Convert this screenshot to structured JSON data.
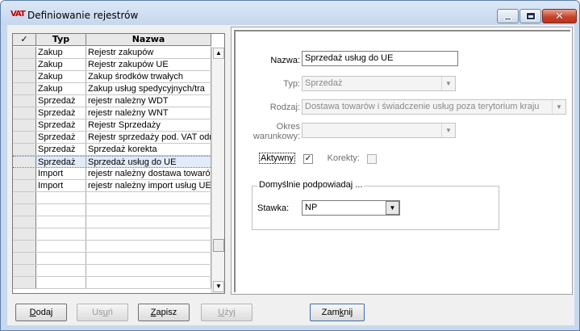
{
  "window": {
    "title": "Definiowanie rejestrów",
    "icon_text": "VAT"
  },
  "grid": {
    "columns": [
      "✓",
      "Typ",
      "Nazwa"
    ],
    "rows": [
      {
        "typ": "Zakup",
        "nazwa": "Rejestr zakupów"
      },
      {
        "typ": "Zakup",
        "nazwa": "Rejestr zakupów UE"
      },
      {
        "typ": "Zakup",
        "nazwa": "Zakup środków trwałych"
      },
      {
        "typ": "Zakup",
        "nazwa": "Zakup usług spedycyjnych/tra"
      },
      {
        "typ": "Sprzedaż",
        "nazwa": "rejestr należny WDT"
      },
      {
        "typ": "Sprzedaż",
        "nazwa": "rejestr należny WNT"
      },
      {
        "typ": "Sprzedaż",
        "nazwa": "Rejestr Sprzedaży"
      },
      {
        "typ": "Sprzedaż",
        "nazwa": "Rejestr sprzedaży pod. VAT odr"
      },
      {
        "typ": "Sprzedaż",
        "nazwa": "Sprzedaż korekta"
      },
      {
        "typ": "Sprzedaż",
        "nazwa": "Sprzedaż usług do UE"
      },
      {
        "typ": "Import",
        "nazwa": "rejestr należny dostawa towaró"
      },
      {
        "typ": "Import",
        "nazwa": "rejestr należny import usług UE"
      }
    ],
    "selected_index": 9,
    "empty_rows": 8
  },
  "form": {
    "nazwa_label": "Nazwa:",
    "nazwa_value": "Sprzedaż usług do UE",
    "typ_label": "Typ:",
    "typ_value": "Sprzedaż",
    "rodzaj_label": "Rodzaj:",
    "rodzaj_value": "Dostawa towarów i świadczenie usług poza terytorium kraju",
    "okres_label_1": "Okres",
    "okres_label_2": "warunkowy:",
    "okres_value": "",
    "aktywny_label": "Aktywny",
    "aktywny_checked": "✓",
    "korekty_label": "Korekty:",
    "group_title": "Domyślnie podpowiadaj ...",
    "stawka_label": "Stawka:",
    "stawka_value": "NP"
  },
  "buttons": {
    "dodaj": {
      "accel": "D",
      "rest": "odaj"
    },
    "usun": {
      "pre": "Us",
      "accel": "u",
      "rest": "ń"
    },
    "zapisz": {
      "accel": "Z",
      "rest": "apisz"
    },
    "uzyj": {
      "accel": "U",
      "rest": "żyj"
    },
    "zamknij": {
      "pre": "Zam",
      "accel": "k",
      "rest": "nij"
    }
  }
}
